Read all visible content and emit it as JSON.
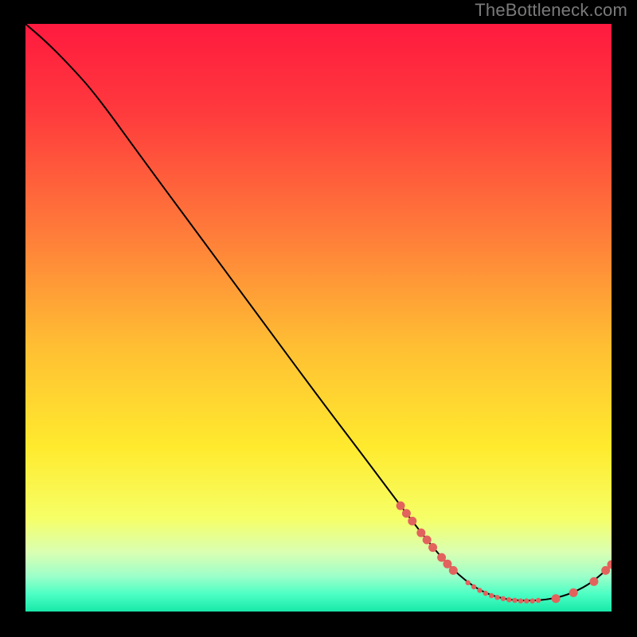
{
  "watermark": "TheBottleneck.com",
  "chart_data": {
    "type": "line",
    "title": "",
    "xlabel": "",
    "ylabel": "",
    "xlim": [
      0,
      100
    ],
    "ylim": [
      0,
      100
    ],
    "gradient_stops": [
      {
        "offset": 0.0,
        "color": "#ff1a3f"
      },
      {
        "offset": 0.15,
        "color": "#ff3a3d"
      },
      {
        "offset": 0.35,
        "color": "#ff7a3a"
      },
      {
        "offset": 0.55,
        "color": "#ffbf33"
      },
      {
        "offset": 0.72,
        "color": "#ffea2e"
      },
      {
        "offset": 0.84,
        "color": "#f6ff66"
      },
      {
        "offset": 0.9,
        "color": "#d9ffb3"
      },
      {
        "offset": 0.94,
        "color": "#9cffc9"
      },
      {
        "offset": 0.97,
        "color": "#4dffc4"
      },
      {
        "offset": 1.0,
        "color": "#18e8a8"
      }
    ],
    "series": [
      {
        "name": "curve",
        "points": [
          {
            "x": 0.0,
            "y": 100.0
          },
          {
            "x": 3.5,
            "y": 97.0
          },
          {
            "x": 7.5,
            "y": 93.0
          },
          {
            "x": 12.0,
            "y": 88.0
          },
          {
            "x": 20.0,
            "y": 77.0
          },
          {
            "x": 30.0,
            "y": 63.5
          },
          {
            "x": 40.0,
            "y": 50.0
          },
          {
            "x": 50.0,
            "y": 36.5
          },
          {
            "x": 58.0,
            "y": 26.0
          },
          {
            "x": 64.0,
            "y": 18.0
          },
          {
            "x": 69.0,
            "y": 11.5
          },
          {
            "x": 73.0,
            "y": 7.0
          },
          {
            "x": 77.0,
            "y": 3.8
          },
          {
            "x": 81.0,
            "y": 2.2
          },
          {
            "x": 85.0,
            "y": 1.8
          },
          {
            "x": 89.0,
            "y": 2.0
          },
          {
            "x": 92.5,
            "y": 2.8
          },
          {
            "x": 96.0,
            "y": 4.5
          },
          {
            "x": 98.5,
            "y": 6.5
          },
          {
            "x": 100.0,
            "y": 8.0
          }
        ]
      }
    ],
    "dots_large": [
      {
        "x": 64.0,
        "y": 18.0
      },
      {
        "x": 65.0,
        "y": 16.7
      },
      {
        "x": 66.0,
        "y": 15.4
      },
      {
        "x": 67.5,
        "y": 13.4
      },
      {
        "x": 68.5,
        "y": 12.2
      },
      {
        "x": 69.5,
        "y": 10.9
      },
      {
        "x": 71.0,
        "y": 9.2
      },
      {
        "x": 72.0,
        "y": 8.1
      },
      {
        "x": 73.0,
        "y": 7.0
      },
      {
        "x": 90.5,
        "y": 2.2
      },
      {
        "x": 93.5,
        "y": 3.2
      },
      {
        "x": 97.0,
        "y": 5.1
      },
      {
        "x": 99.0,
        "y": 7.0
      },
      {
        "x": 100.0,
        "y": 8.0
      }
    ],
    "dots_small": [
      {
        "x": 75.5,
        "y": 4.9
      },
      {
        "x": 76.5,
        "y": 4.2
      },
      {
        "x": 77.5,
        "y": 3.6
      },
      {
        "x": 78.5,
        "y": 3.1
      },
      {
        "x": 79.5,
        "y": 2.7
      },
      {
        "x": 80.5,
        "y": 2.4
      },
      {
        "x": 81.5,
        "y": 2.2
      },
      {
        "x": 82.5,
        "y": 2.0
      },
      {
        "x": 83.5,
        "y": 1.9
      },
      {
        "x": 84.5,
        "y": 1.8
      },
      {
        "x": 85.5,
        "y": 1.8
      },
      {
        "x": 86.5,
        "y": 1.8
      },
      {
        "x": 87.5,
        "y": 1.9
      }
    ],
    "dot_color": "#e2635d",
    "line_color": "#000000"
  }
}
